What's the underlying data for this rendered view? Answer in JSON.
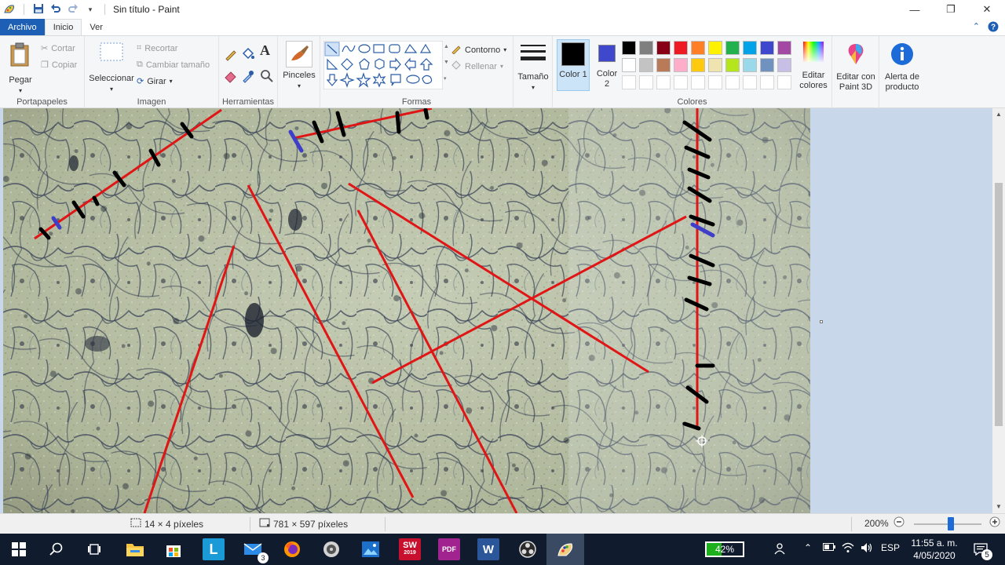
{
  "window": {
    "title": "Sin título - Paint"
  },
  "tabs": {
    "file": "Archivo",
    "home": "Inicio",
    "view": "Ver"
  },
  "clipboard": {
    "paste": "Pegar",
    "cut": "Cortar",
    "copy": "Copiar",
    "group": "Portapapeles"
  },
  "image": {
    "select": "Seleccionar",
    "crop": "Recortar",
    "resize": "Cambiar tamaño",
    "rotate": "Girar",
    "group": "Imagen"
  },
  "tools": {
    "group": "Herramientas"
  },
  "brushes": {
    "label": "Pinceles"
  },
  "shapes": {
    "outline": "Contorno",
    "fill": "Rellenar",
    "group": "Formas"
  },
  "size": {
    "label": "Tamaño"
  },
  "colors": {
    "color1": "Color 1",
    "color2": "Color 2",
    "edit": "Editar colores",
    "group": "Colores",
    "color1_value": "#000000",
    "color2_value": "#3f48cc",
    "palette_row1": [
      "#000000",
      "#7f7f7f",
      "#880015",
      "#ed1c24",
      "#ff7f27",
      "#fff200",
      "#22b14c",
      "#00a2e8",
      "#3f48cc",
      "#a349a4"
    ],
    "palette_row2": [
      "#ffffff",
      "#c3c3c3",
      "#b97a57",
      "#ffaec9",
      "#ffc90e",
      "#efe4b0",
      "#b5e61d",
      "#99d9ea",
      "#7092be",
      "#c8bfe7"
    ]
  },
  "paint3d": {
    "label": "Editar con Paint 3D"
  },
  "alert": {
    "label": "Alerta de producto"
  },
  "status": {
    "selection": "14 × 4 píxeles",
    "canvas": "781 × 597 píxeles",
    "zoom": "200%",
    "zoom_level": 0.55
  },
  "taskbar": {
    "mail_badge": "3",
    "battery": "42%",
    "battery_level": 0.42,
    "lang": "ESP",
    "time": "11:55 a. m.",
    "date": "4/05/2020",
    "notifications": "5",
    "sw_label": "SW",
    "sw_year": "2019",
    "l_app": "L",
    "pdf_label": "PDF",
    "word_label": "W"
  }
}
